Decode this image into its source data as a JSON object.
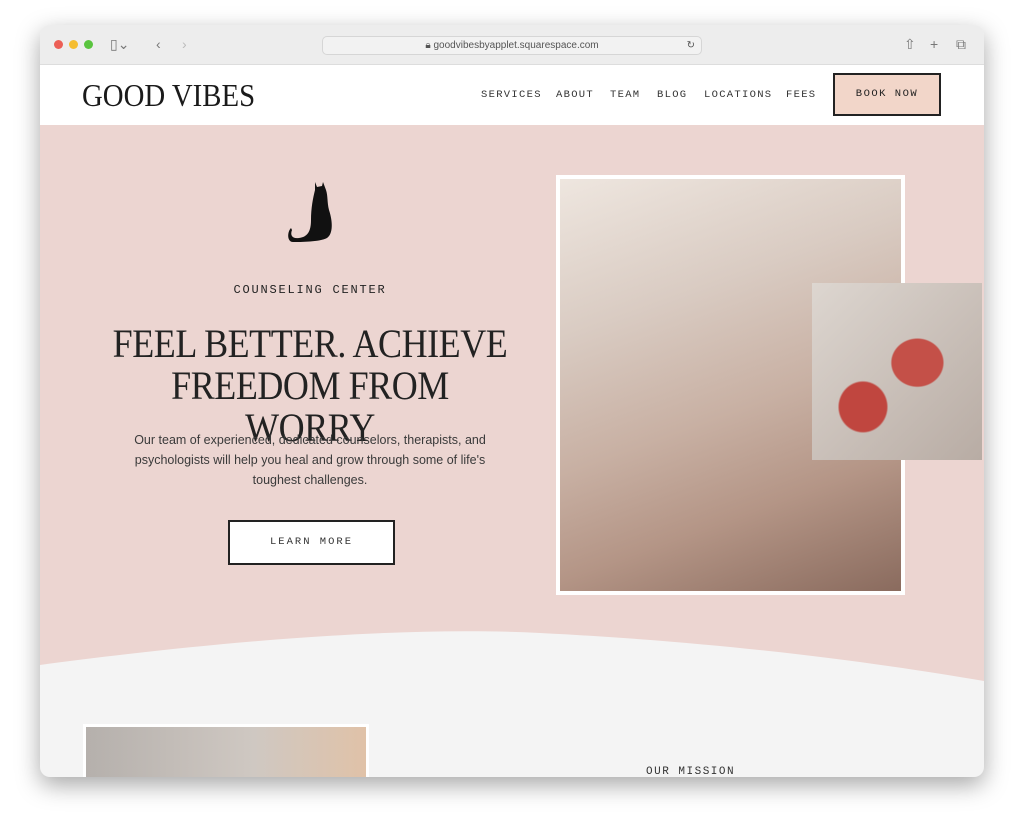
{
  "browser": {
    "url": "goodvibesbyapplet.squarespace.com"
  },
  "header": {
    "logo": "GOOD VIBES",
    "nav": [
      "SERVICES",
      "ABOUT",
      "TEAM",
      "BLOG",
      "LOCATIONS",
      "FEES"
    ],
    "book_now": "BOOK NOW"
  },
  "hero": {
    "eyebrow": "COUNSELING CENTER",
    "headline_1": "FEEL BETTER. ACHIEVE",
    "headline_2": "FREEDOM FROM WORRY",
    "body": "Our team of experienced, dedicated counselors, therapists, and psychologists will help you heal and grow through some of life's toughest challenges.",
    "cta": "LEARN MORE"
  },
  "mission": {
    "label": "OUR MISSION"
  },
  "colors": {
    "hero_bg": "#ecd5d1",
    "book_btn": "#f2d6c9",
    "section_bg": "#f4f4f4"
  }
}
